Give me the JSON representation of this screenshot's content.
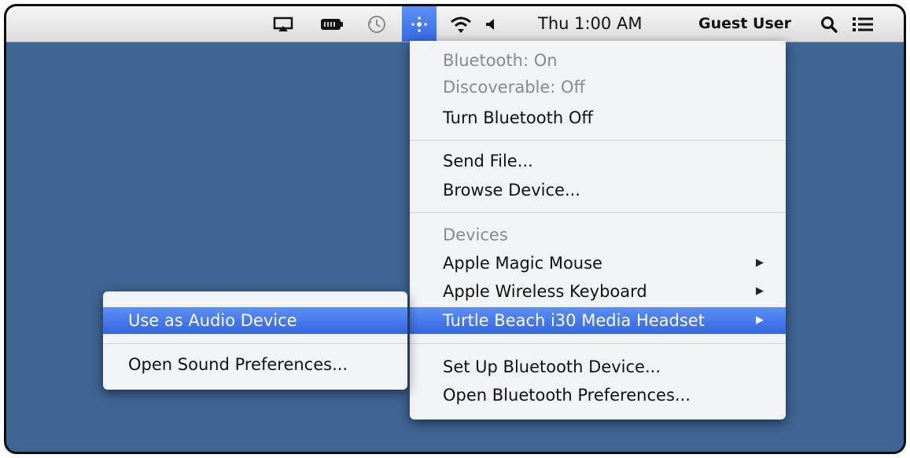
{
  "menubar": {
    "icons": [
      {
        "name": "airplay-icon",
        "glyph": "▭"
      },
      {
        "name": "battery-icon",
        "glyph": "▬"
      },
      {
        "name": "time-machine-icon",
        "glyph": "◷"
      },
      {
        "name": "bluetooth-icon",
        "glyph": "✧"
      },
      {
        "name": "wifi-icon",
        "glyph": "wifi"
      },
      {
        "name": "volume-icon",
        "glyph": "◀"
      }
    ],
    "clock": "Thu 1:00 AM",
    "user": "Guest User",
    "search_icon": "search-icon",
    "list_icon": "notification-list-icon"
  },
  "bluetooth_menu": {
    "status": "Bluetooth: On",
    "discoverable": "Discoverable: Off",
    "toggle": "Turn Bluetooth Off",
    "send_file": "Send File...",
    "browse_device": "Browse Device...",
    "devices_header": "Devices",
    "devices": [
      {
        "label": "Apple Magic Mouse"
      },
      {
        "label": "Apple Wireless Keyboard"
      },
      {
        "label": "Turtle Beach i30 Media Headset"
      }
    ],
    "setup": "Set Up Bluetooth Device...",
    "preferences": "Open Bluetooth Preferences...",
    "arrow_glyph": "▶"
  },
  "device_submenu": {
    "use_audio": "Use as Audio Device",
    "sound_prefs": "Open Sound Preferences..."
  },
  "colors": {
    "desktop": "#3f6594",
    "highlight": "#3a6ee8",
    "menu_bg": "#f6f6f6"
  }
}
